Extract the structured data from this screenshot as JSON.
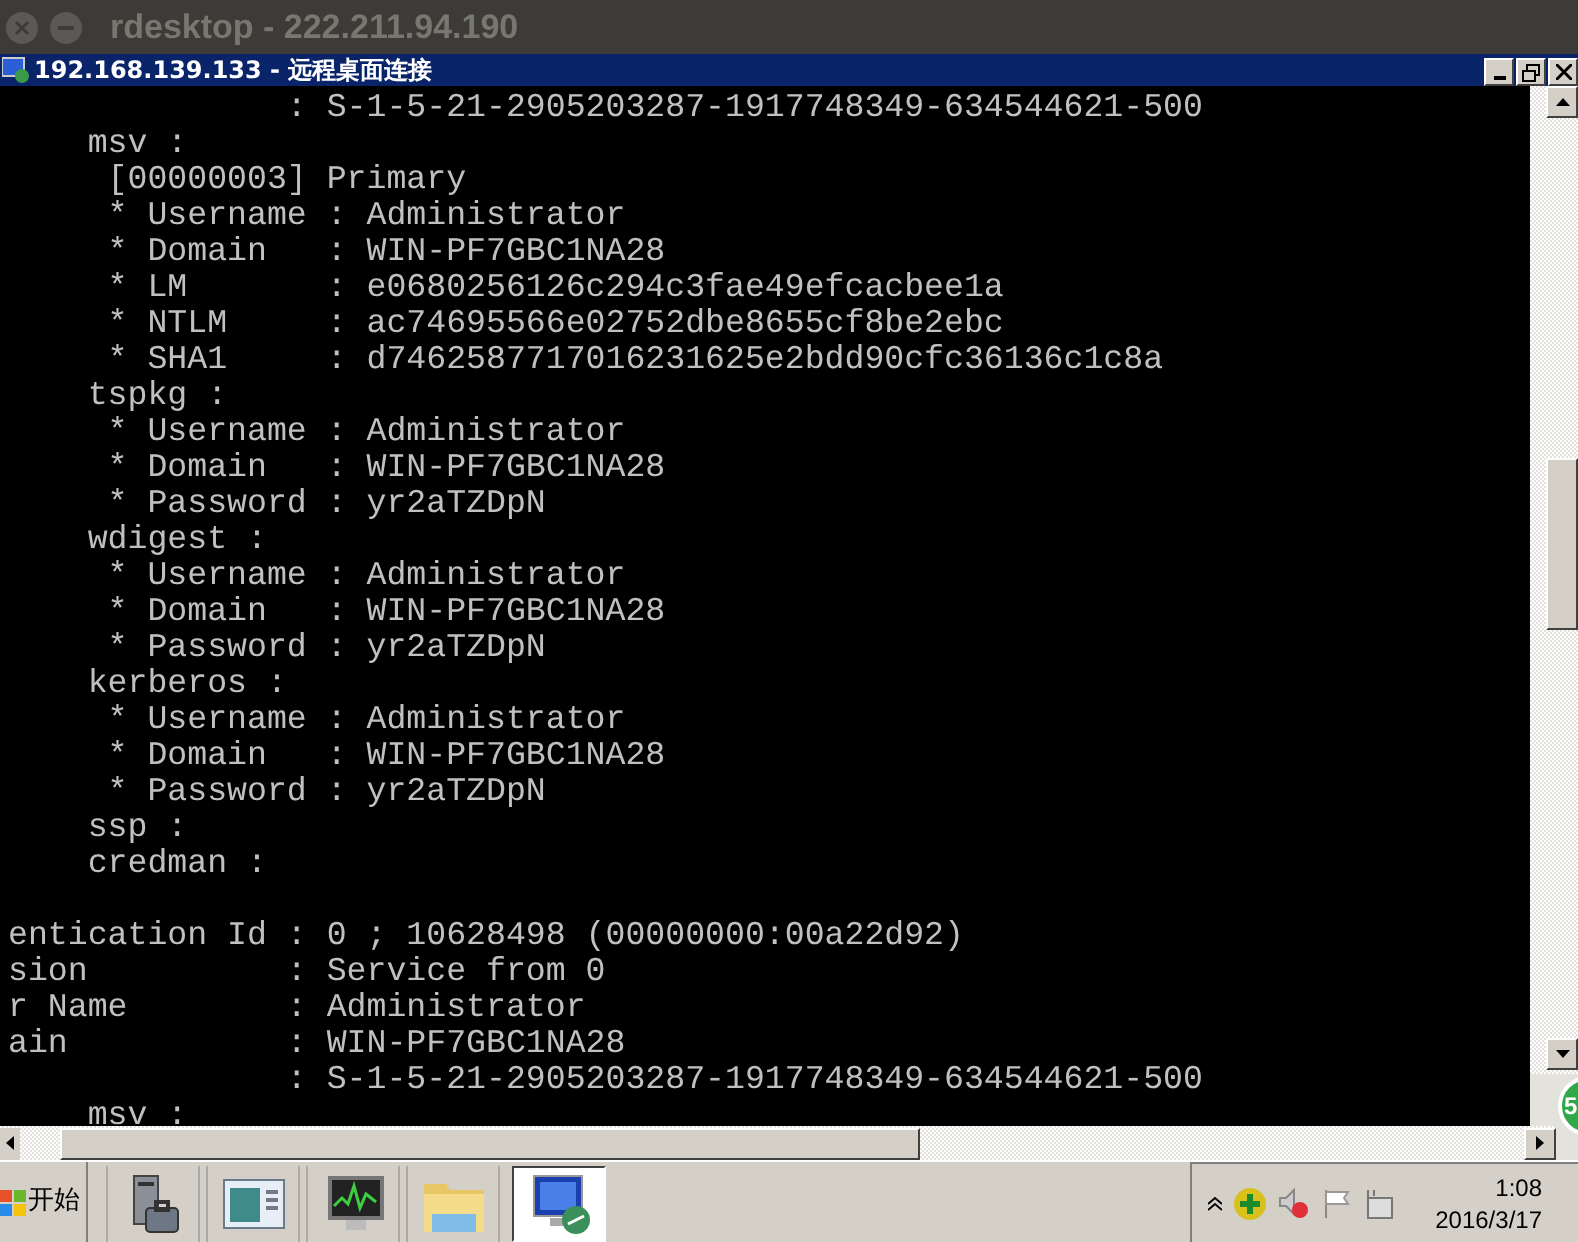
{
  "window": {
    "title": "rdesktop - 222.211.94.190"
  },
  "remote_window": {
    "title": "192.168.139.133 - 远程桌面连接"
  },
  "console": {
    "blocks": [
      {
        "lines": [
          "              : S-1-5-21-2905203287-1917748349-634544621-500",
          "    msv :",
          "     [00000003] Primary",
          "     * Username : Administrator",
          "     * Domain   : WIN-PF7GBC1NA28",
          "     * LM       : e0680256126c294c3fae49efcacbee1a",
          "     * NTLM     : ac74695566e02752dbe8655cf8be2ebc",
          "     * SHA1     : d7462587717016231625e2bdd90cfc36136c1c8a",
          "    tspkg :",
          "     * Username : Administrator",
          "     * Domain   : WIN-PF7GBC1NA28",
          "     * Password : yr2aTZDpN",
          "    wdigest :",
          "     * Username : Administrator",
          "     * Domain   : WIN-PF7GBC1NA28",
          "     * Password : yr2aTZDpN",
          "    kerberos :",
          "     * Username : Administrator",
          "     * Domain   : WIN-PF7GBC1NA28",
          "     * Password : yr2aTZDpN",
          "    ssp :",
          "    credman :"
        ]
      },
      {
        "lines": [
          "entication Id : 0 ; 10628498 (00000000:00a22d92)",
          "sion          : Service from 0",
          "r Name        : Administrator",
          "ain           : WIN-PF7GBC1NA28",
          "              : S-1-5-21-2905203287-1917748349-634544621-500",
          "    msv :"
        ]
      }
    ]
  },
  "floating_badge": {
    "label": "5"
  },
  "taskbar": {
    "start": "开始",
    "buttons": [
      {
        "kind": "server-tools",
        "selected": false
      },
      {
        "kind": "window",
        "selected": false
      },
      {
        "kind": "monitor",
        "selected": false
      },
      {
        "kind": "folder",
        "selected": false
      },
      {
        "kind": "remote-desktop",
        "selected": true
      }
    ],
    "tray": {
      "time": "1:08",
      "date": "2016/3/17"
    }
  }
}
